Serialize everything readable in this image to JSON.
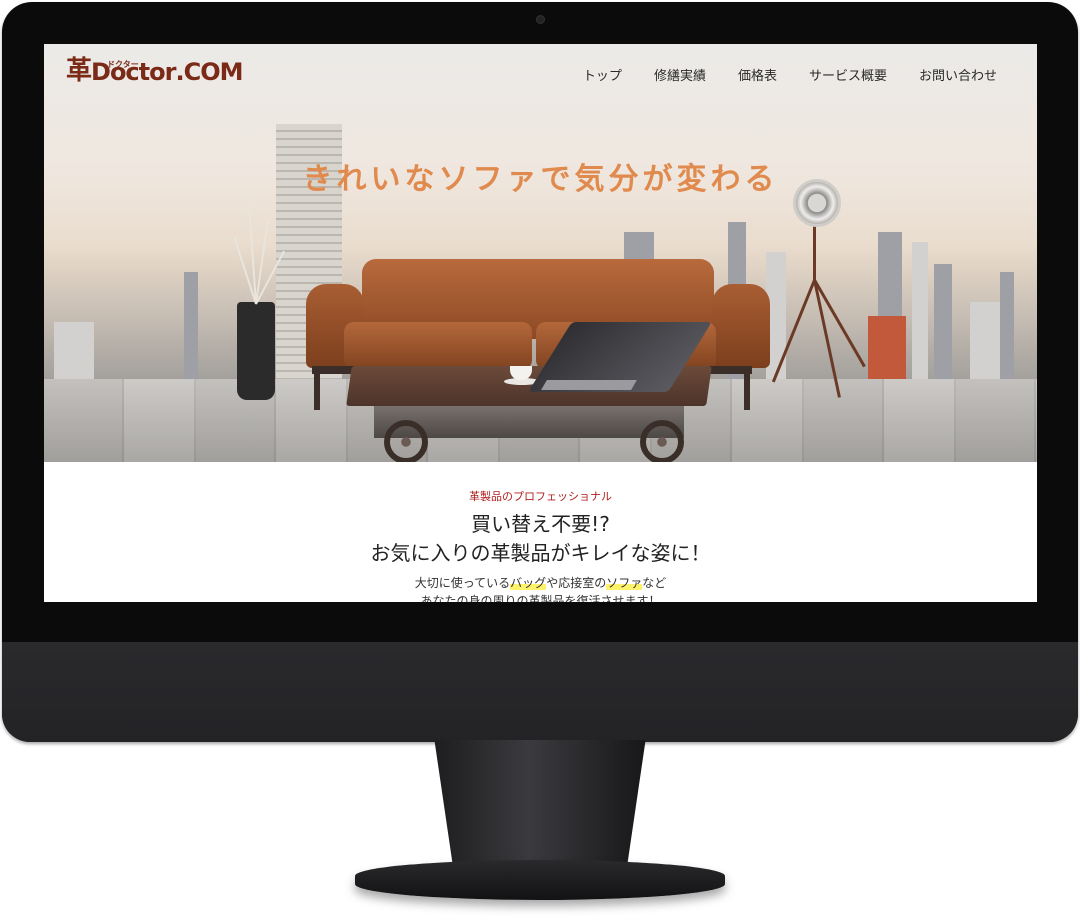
{
  "site": {
    "logo": {
      "kanji": "革",
      "doctor": "Doctor",
      "ruby": "ドクター",
      "dot": ".",
      "com": "COM"
    },
    "nav": [
      "トップ",
      "修繕実績",
      "価格表",
      "サービス概要",
      "お問い合わせ"
    ],
    "hero_catch": "きれいなソファで気分が変わる"
  },
  "intro": {
    "eyebrow": "革製品のプロフェッショナル",
    "headline_1": "買い替え不要!?",
    "headline_2": "お気に入りの革製品がキレイな姿に！",
    "lead_1": {
      "a": "大切に使っている",
      "b": "バッグ",
      "c": "や応接室の",
      "d": "ソファ",
      "e": "など"
    },
    "lead_2": "あなたの身の周りの革製品を復活させます！"
  },
  "colors": {
    "logo": "#7a2a16",
    "catch": "#e08a4e",
    "eyebrow": "#b01e1e",
    "highlight": "#fff26b"
  }
}
